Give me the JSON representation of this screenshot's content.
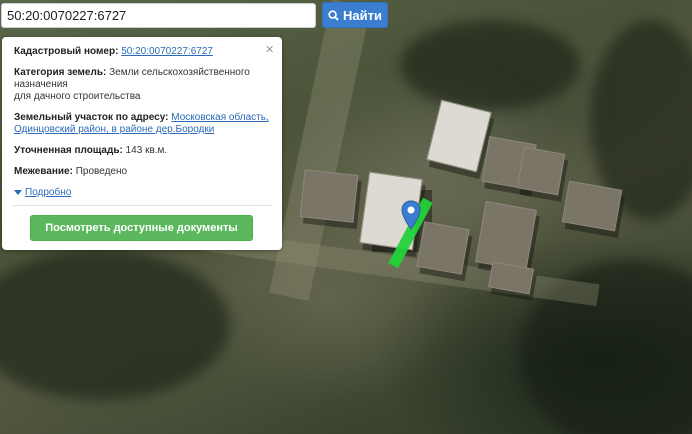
{
  "search": {
    "value": "50:20:0070227:6727",
    "button_label": "Найти",
    "button_icon": "search-icon"
  },
  "popup": {
    "cadastral_label": "Кадастровый номер:",
    "cadastral_value": "50:20:0070227:6727",
    "category_label": "Категория земель:",
    "category_value_line1": "Земли сельскохозяйственного",
    "category_value_line2": "назначения",
    "category_value_line3": "для дачного строительства",
    "address_label": "Земельный участок по адресу:",
    "address_value_line1": "Московская область,",
    "address_value_line2": "Одинцовский район, в районе дер.Бородки",
    "area_label": "Уточненная площадь:",
    "area_value": "143 кв.м.",
    "survey_label": "Межевание:",
    "survey_value": "Проведено",
    "more_label": "Подробно",
    "docs_button": "Посмотреть доступные документы",
    "close_symbol": "×"
  },
  "colors": {
    "search_button": "#3b7ed0",
    "docs_button": "#5cb85c",
    "link": "#2a6ab8",
    "plot": "#22d23a",
    "marker": "#3b7ed0"
  }
}
